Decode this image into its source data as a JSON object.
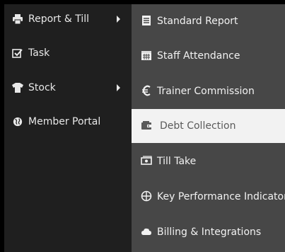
{
  "menu": {
    "items": [
      {
        "label": "Report & Till",
        "icon": "printer-icon",
        "has_submenu": true
      },
      {
        "label": "Task",
        "icon": "checkbox-icon",
        "has_submenu": false
      },
      {
        "label": "Stock",
        "icon": "tshirt-icon",
        "has_submenu": true
      },
      {
        "label": "Member Portal",
        "icon": "globe-icon",
        "has_submenu": false
      }
    ]
  },
  "submenu": {
    "items": [
      {
        "label": "Standard Report",
        "icon": "document-icon"
      },
      {
        "label": "Staff Attendance",
        "icon": "calendar-icon"
      },
      {
        "label": "Trainer Commission",
        "icon": "euro-icon"
      },
      {
        "label": "Debt Collection",
        "icon": "wallet-icon",
        "active": true
      },
      {
        "label": "Till Take",
        "icon": "money-icon"
      },
      {
        "label": "Key Performance Indicators",
        "icon": "crosshair-icon"
      },
      {
        "label": "Billing & Integrations",
        "icon": "cloud-icon"
      }
    ]
  },
  "colors": {
    "left_panel": "#1f1f1f",
    "right_panel": "#474747",
    "active_bg": "#f2f2f2",
    "active_text": "#5a5a5a",
    "text": "#f2f2f2"
  }
}
